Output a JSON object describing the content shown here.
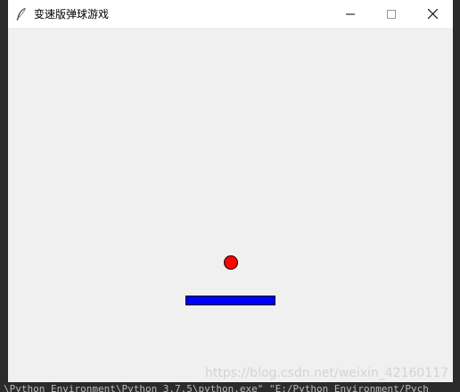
{
  "window": {
    "title": "变速版弹球游戏",
    "controls": {
      "minimize_icon": "minimize-icon",
      "maximize_icon": "maximize-icon",
      "close_icon": "close-icon"
    }
  },
  "game": {
    "ball_color": "#ff0000",
    "paddle_color": "#0000ff",
    "canvas_background": "#f0f0f0"
  },
  "watermark": "https://blog.csdn.net/weixin_42160117",
  "background_terminal": {
    "command_line": "\\Python Environment\\Python 3.7.5\\python.exe\" \"E:/Python Environment/Pych"
  }
}
